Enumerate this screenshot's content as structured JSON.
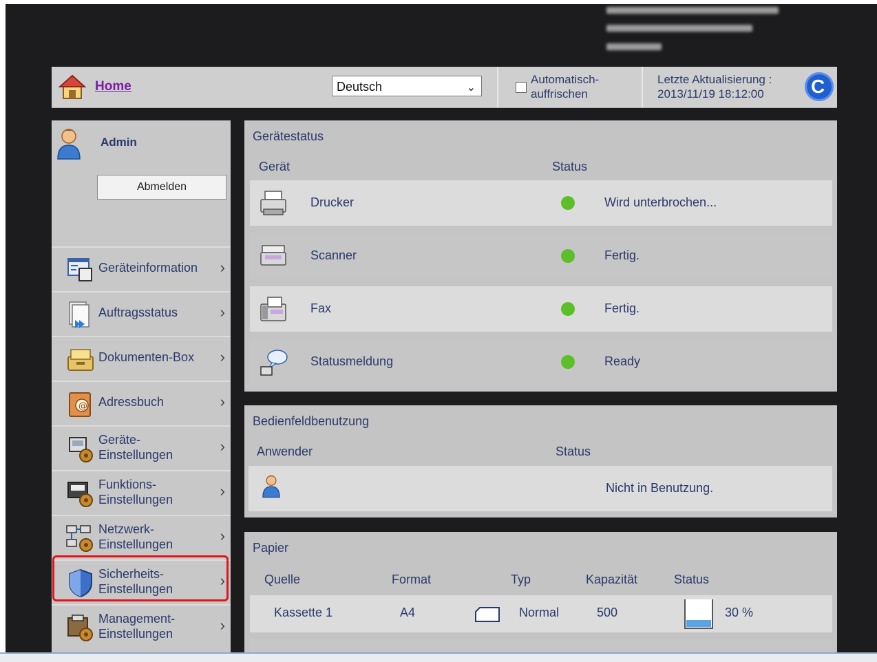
{
  "header": {
    "home_label": "Home",
    "language": "Deutsch",
    "auto_refresh_label": "Automatisch-auffrischen",
    "auto_refresh_line1": "Automatisch-",
    "auto_refresh_line2": "auffrischen",
    "last_update_label": "Letzte Aktualisierung :",
    "last_update_value": "2013/11/19 18:12:00"
  },
  "user": {
    "name": "Admin",
    "logout_label": "Abmelden"
  },
  "sidebar": {
    "items": [
      {
        "l1": "Geräteinformation",
        "l2": ""
      },
      {
        "l1": "Auftragsstatus",
        "l2": ""
      },
      {
        "l1": "Dokumenten-Box",
        "l2": ""
      },
      {
        "l1": "Adressbuch",
        "l2": ""
      },
      {
        "l1": "Geräte-",
        "l2": "Einstellungen"
      },
      {
        "l1": "Funktions-",
        "l2": "Einstellungen"
      },
      {
        "l1": "Netzwerk-",
        "l2": "Einstellungen"
      },
      {
        "l1": "Sicherheits-",
        "l2": "Einstellungen"
      },
      {
        "l1": "Management-",
        "l2": "Einstellungen"
      }
    ],
    "highlighted": "Sicherheits-Einstellungen"
  },
  "device_status": {
    "title": "Gerätestatus",
    "col_device": "Gerät",
    "col_status": "Status",
    "rows": [
      {
        "device": "Drucker",
        "status": "Wird unterbrochen..."
      },
      {
        "device": "Scanner",
        "status": "Fertig."
      },
      {
        "device": "Fax",
        "status": "Fertig."
      },
      {
        "device": "Statusmeldung",
        "status": "Ready"
      }
    ],
    "status_color": "#5cbf2a"
  },
  "panel_usage": {
    "title": "Bedienfeldbenutzung",
    "col_user": "Anwender",
    "col_status": "Status",
    "status": "Nicht in Benutzung."
  },
  "paper": {
    "title": "Papier",
    "columns": [
      "Quelle",
      "Format",
      "Typ",
      "Kapazität",
      "Status"
    ],
    "rows": [
      {
        "source": "Kassette 1",
        "format": "A4",
        "type": "Normal",
        "capacity": "500",
        "level": "30 %"
      }
    ]
  }
}
